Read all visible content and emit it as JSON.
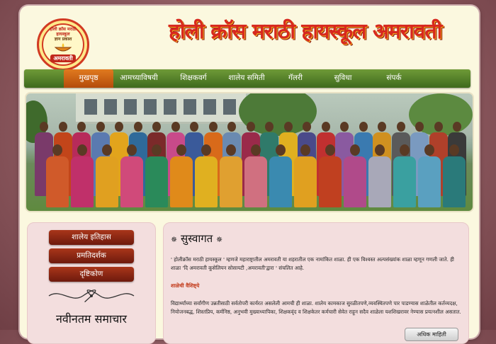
{
  "header": {
    "school_title": "होली क्रॉस मराठी हायस्कूल अमरावती",
    "logo": {
      "ring_text": "होली क्रॉस मराठी हायस्कूल",
      "motto": "ज्ञान प्रकाश",
      "city": "अमरावती"
    }
  },
  "nav": {
    "items": [
      {
        "label": "मुखपृष्ठ",
        "active": true
      },
      {
        "label": "आमच्याविषयी",
        "active": false
      },
      {
        "label": "शिक्षकवर्ग",
        "active": false
      },
      {
        "label": "शालेय समिती",
        "active": false
      },
      {
        "label": "गॅलरी",
        "active": false
      },
      {
        "label": "सुविधा",
        "active": false
      },
      {
        "label": "संपर्क",
        "active": false
      }
    ]
  },
  "sidebar": {
    "buttons": [
      "शालेय इतिहास",
      "प्रमतिदर्शक",
      "दृष्टिकोण"
    ],
    "news_title": "नवीनतम समाचार"
  },
  "welcome": {
    "star": "✵",
    "title": "सुस्वागत",
    "intro": "' होलीक्रॉस मराठी हायस्कूल ' म्हणजे महाराष्ट्रातील अमरावती या शहरातील एक नामांकित शाळा. ही एक विश्वस्त अल्पसंख्यांक शाळा म्हणून गणली जाते. ही शाळा 'दि अमरावती कूसेलियन सोसायटी ,अमरावती'द्वारा ' संचलित आहे.",
    "subheading": "शाळेची वैशिष्ट्ये",
    "features": "विद्यार्थ्यांच्या सर्वांगीण उन्नतीसाठी सर्वतोपरी कार्यरत असलेली आमची ही शाळा. शालेय कामकाज सुरळीतपणे,व्यवस्थितपणे पार पाडण्यास शाळेतील कर्तव्यदक्ष, नियोजनबद्ध, शिस्तप्रिय, कर्मनिष्ठ, अनुभवी मुख्याध्यापिका, शिक्षकवृंद व शिक्षकेतर कर्मचारी सेवेत राहून सदैव शाळेला यशशिखरावर नेण्यास प्रयत्नशील असतात.",
    "more_button": "अधिक माहिती"
  },
  "colors": {
    "nav_green": "#4f7c26",
    "active_orange": "#d26a16",
    "button_maroon": "#8a2612",
    "panel_pink": "#f3dede",
    "page_cream": "#fbf8df",
    "title_red": "#d7281e"
  }
}
